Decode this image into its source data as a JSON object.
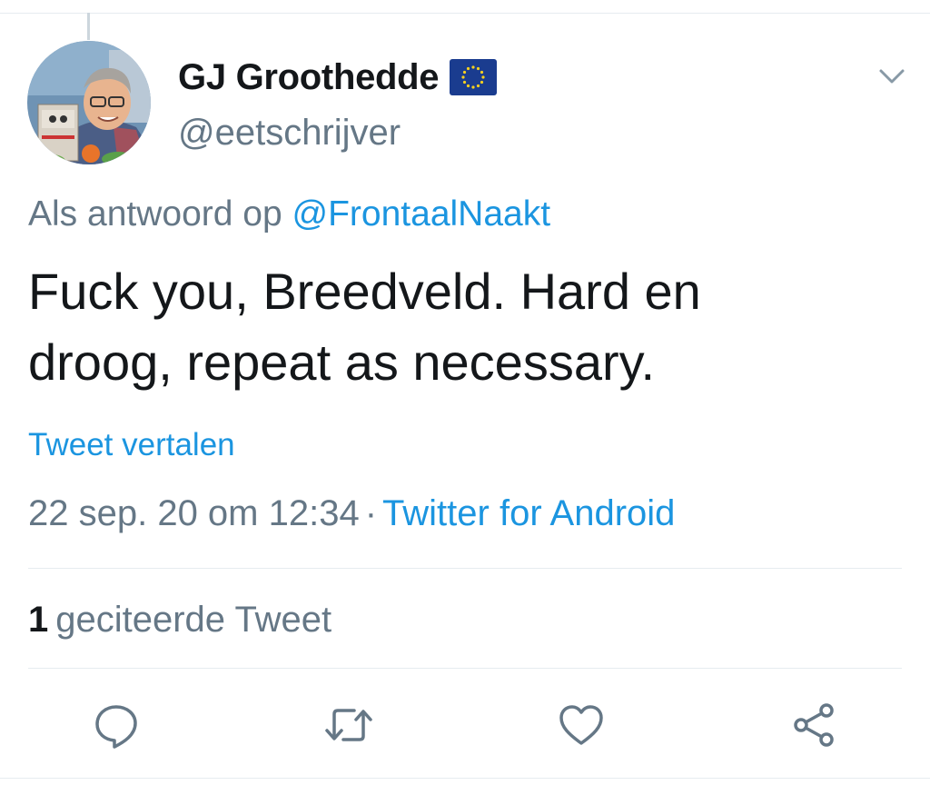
{
  "author": {
    "display_name": "GJ Groothedde",
    "handle": "@eetschrijver",
    "flag_icon": "eu-flag-icon",
    "avatar_icon": "avatar-photo"
  },
  "reply_context": {
    "prefix": "Als antwoord op",
    "mention": "@FrontaalNaakt"
  },
  "tweet": {
    "text_line1": "Fuck you, Breedveld. Hard en",
    "text_line2": "droog, repeat as necessary.",
    "translate_label": "Tweet vertalen",
    "timestamp": "22 sep. 20 om 12:34",
    "separator": "·",
    "source": "Twitter for Android"
  },
  "stats": {
    "quote_count": "1",
    "quote_label": "geciteerde Tweet"
  },
  "actions": {
    "reply_icon": "reply-icon",
    "retweet_icon": "retweet-icon",
    "like_icon": "heart-icon",
    "share_icon": "share-icon",
    "menu_icon": "chevron-down-icon"
  },
  "colors": {
    "link": "#1b95e0",
    "secondary_text": "#657786",
    "primary_text": "#14171a",
    "icon": "#657786",
    "divider": "#e6ecf0"
  }
}
